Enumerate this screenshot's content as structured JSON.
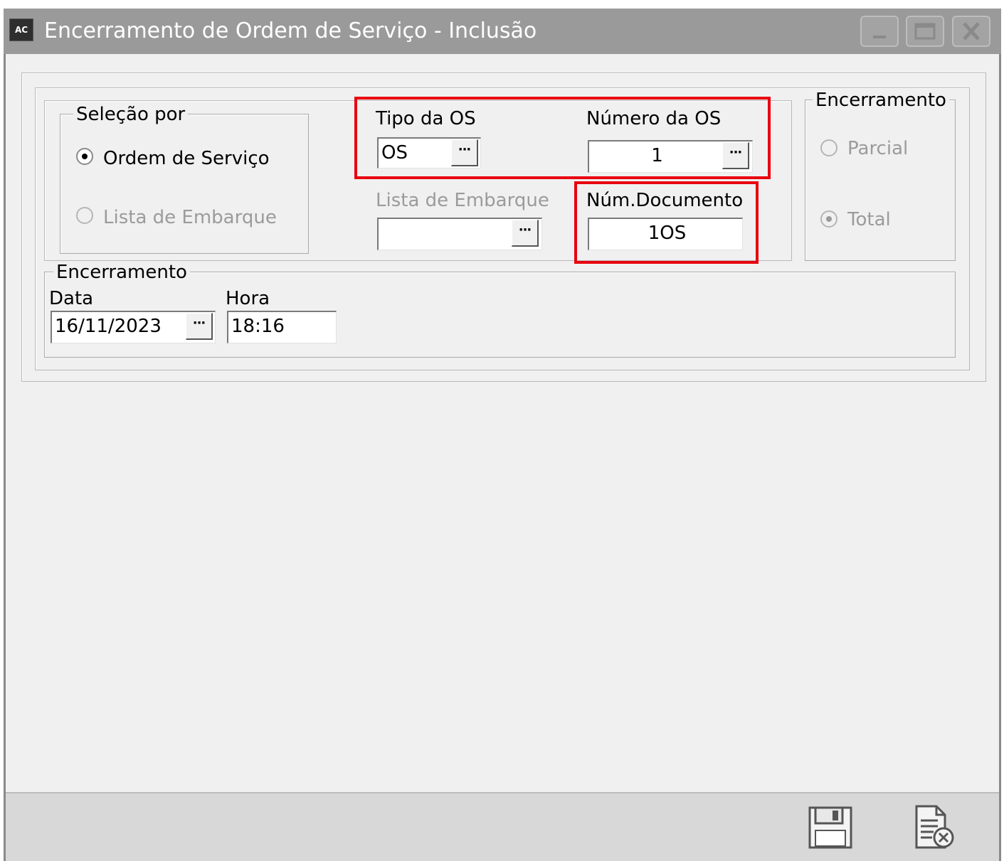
{
  "window": {
    "app_icon_text": "AC",
    "title": "Encerramento de Ordem de Serviço - Inclusão"
  },
  "selecao": {
    "legend": "Seleção por",
    "options": [
      {
        "label": "Ordem de Serviço",
        "selected": true,
        "enabled": true
      },
      {
        "label": "Lista de Embarque",
        "selected": false,
        "enabled": false
      }
    ]
  },
  "tipo_os": {
    "label": "Tipo da OS",
    "value": "OS"
  },
  "numero_os": {
    "label": "Número da OS",
    "value": "1"
  },
  "lista_embarque": {
    "label": "Lista de Embarque",
    "value": ""
  },
  "num_documento": {
    "label": "Núm.Documento",
    "value": "1OS"
  },
  "encerramento_tipo": {
    "legend": "Encerramento",
    "options": [
      {
        "label": "Parcial",
        "selected": false,
        "enabled": false
      },
      {
        "label": "Total",
        "selected": true,
        "enabled": false
      }
    ]
  },
  "encerramento_data": {
    "legend": "Encerramento",
    "data_label": "Data",
    "data_value": "16/11/2023",
    "hora_label": "Hora",
    "hora_value": "18:16"
  },
  "ellipsis": "···",
  "colors": {
    "highlight": "#e8000f",
    "titlebar": "#9a9a9a",
    "window_bg": "#f0f0f0"
  },
  "footer": {
    "icons": [
      "save-icon",
      "cancel-document-icon"
    ]
  }
}
